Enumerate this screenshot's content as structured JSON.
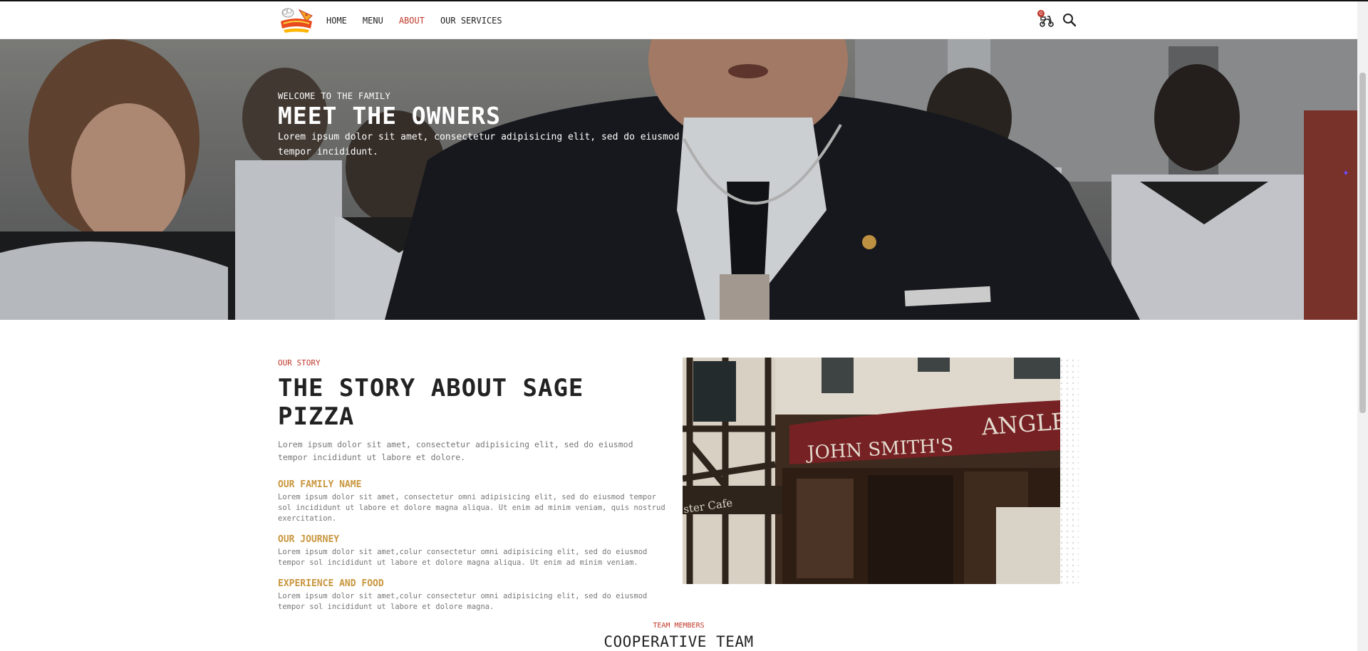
{
  "nav": {
    "logo_alt": "Pizza",
    "links": [
      {
        "label": "HOME"
      },
      {
        "label": "MENU"
      },
      {
        "label": "ABOUT"
      },
      {
        "label": "OUR SERVICES"
      }
    ],
    "active_index": 2,
    "cart_count": "0",
    "cart_icon": "scooter-cart-icon",
    "search_icon": "search-icon"
  },
  "hero": {
    "eyebrow": "WELCOME TO THE FAMILY",
    "title": "MEET THE OWNERS",
    "description": "Lorem ipsum dolor sit amet, consectetur adipisicing elit, sed do eiusmod tempor incididunt."
  },
  "story": {
    "eyebrow": "OUR STORY",
    "title": "THE STORY ABOUT SAGE PIZZA",
    "intro": "Lorem ipsum dolor sit amet, consectetur adipisicing elit, sed do eiusmod tempor incididunt ut labore et dolore.",
    "features": [
      {
        "title": "OUR FAMILY NAME",
        "desc": "Lorem ipsum dolor sit amet, consectetur omni adipisicing elit, sed do eiusmod tempor sol incididunt ut labore et dolore magna aliqua. Ut enim ad minim veniam, quis nostrud exercitation."
      },
      {
        "title": "OUR JOURNEY",
        "desc": "Lorem ipsum dolor sit amet,colur consectetur omni adipisicing elit, sed do eiusmod tempor sol incididunt ut labore et dolore magna aliqua. Ut enim ad minim veniam."
      },
      {
        "title": "EXPERIENCE AND FOOD",
        "desc": "Lorem ipsum dolor sit amet,colur consectetur omni adipisicing elit, sed do eiusmod tempor sol incididunt ut labore et dolore magna."
      }
    ],
    "image_signs": {
      "left": "JOHN SMITH'S",
      "right": "ANGLE",
      "side": "ster Cafe"
    }
  },
  "team": {
    "eyebrow": "TEAM MEMBERS",
    "title": "COOPERATIVE TEAM"
  },
  "colors": {
    "accent_red": "#c0392b",
    "accent_gold": "#c8963e"
  }
}
